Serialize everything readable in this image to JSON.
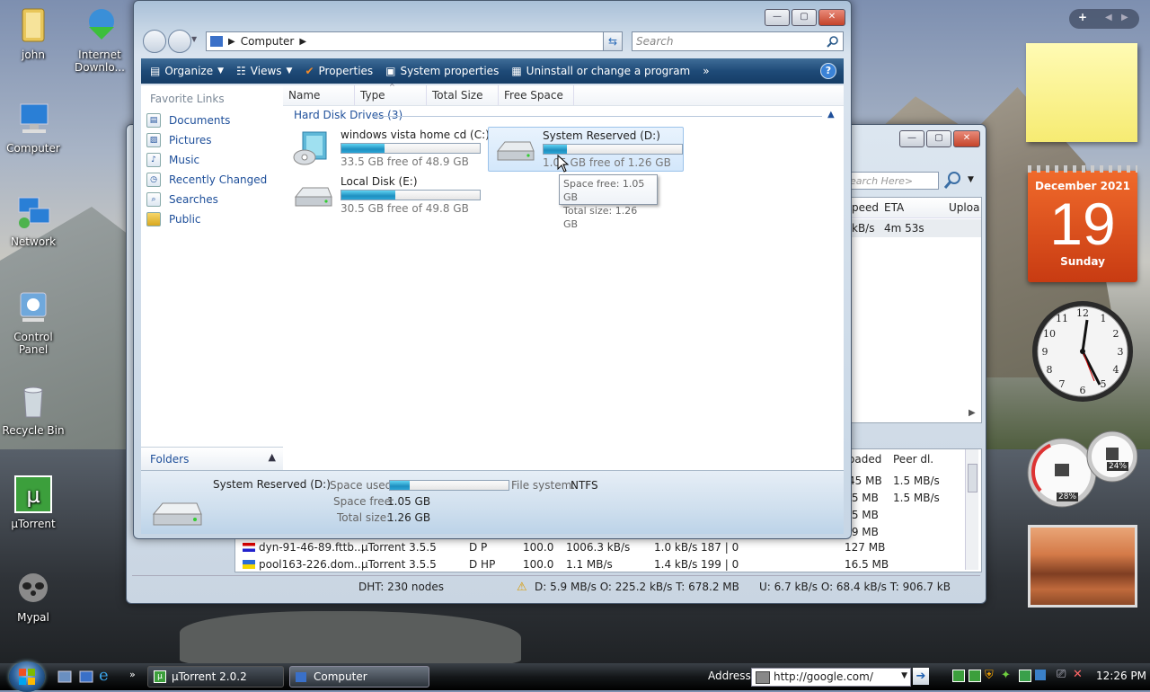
{
  "desktop": {
    "icons": [
      {
        "label": "john"
      },
      {
        "label": "Internet Downlo..."
      },
      {
        "label": "Computer"
      },
      {
        "label": "Network"
      },
      {
        "label": "Control Panel"
      },
      {
        "label": "Recycle Bin"
      },
      {
        "label": "µTorrent"
      },
      {
        "label": "Mypal"
      }
    ]
  },
  "explorer": {
    "address": "Computer",
    "search_placeholder": "Search",
    "toolbar": {
      "organize": "Organize",
      "views": "Views",
      "properties": "Properties",
      "system_properties": "System properties",
      "uninstall": "Uninstall or change a program",
      "more": "»"
    },
    "favorites_header": "Favorite Links",
    "favorites": [
      {
        "label": "Documents"
      },
      {
        "label": "Pictures"
      },
      {
        "label": "Music"
      },
      {
        "label": "Recently Changed"
      },
      {
        "label": "Searches"
      },
      {
        "label": "Public"
      }
    ],
    "folders_label": "Folders",
    "columns": [
      "Name",
      "Type",
      "Total Size",
      "Free Space"
    ],
    "group_header": "Hard Disk Drives (3)",
    "drives": [
      {
        "name": "windows vista home cd (C:)",
        "free": "33.5 GB free of 48.9 GB",
        "used_fraction": 0.31
      },
      {
        "name": "System Reserved (D:)",
        "free": "1.05 GB free of 1.26 GB",
        "used_fraction": 0.17
      },
      {
        "name": "Local Disk (E:)",
        "free": "30.5 GB free of 49.8 GB",
        "used_fraction": 0.39
      }
    ],
    "tooltip": {
      "line1": "Space free: 1.05 GB",
      "line2": "Total size: 1.26 GB"
    },
    "details": {
      "name": "System Reserved (D:)",
      "space_used_label": "Space used:",
      "space_used_fraction": 0.17,
      "filesystem_label": "File system:",
      "filesystem_value": "NTFS",
      "space_free_label": "Space free:",
      "space_free_value": "1.05 GB",
      "total_size_label": "Total size:",
      "total_size_value": "1.26 GB"
    }
  },
  "utorrent": {
    "search_placeholder": "earch Here>",
    "top_cols": {
      "speed": "peed",
      "eta": "ETA",
      "upload": "Uploa"
    },
    "top_row": {
      "speed": "kB/s",
      "eta": "4m 53s"
    },
    "peer_cols": {
      "loaded": "oaded",
      "peer_dl": "Peer dl."
    },
    "peer_partial": [
      {
        "loaded": "45 MB",
        "peer_dl": "1.5 MB/s"
      },
      {
        "loaded": ".5 MB",
        "peer_dl": "1.5 MB/s"
      },
      {
        "loaded": ".5 MB",
        "peer_dl": ""
      },
      {
        "loaded": ".9 MB",
        "peer_dl": ""
      }
    ],
    "peers": [
      {
        "host": "dyn-91-46-89.fttb...",
        "client": "µTorrent 3.5.5",
        "flags": "D P",
        "pct": "100.0",
        "down": "1006.3 kB/s",
        "up": "1.0 kB/s",
        "reqs": "187 | 0",
        "downloaded": "127 MB"
      },
      {
        "host": "pool163-226.dom...",
        "client": "µTorrent 3.5.5",
        "flags": "D HP",
        "pct": "100.0",
        "down": "1.1 MB/s",
        "up": "1.4 kB/s",
        "reqs": "199 | 0",
        "downloaded": "16.5 MB"
      }
    ],
    "status": {
      "dht": "DHT: 230 nodes",
      "download": "D: 5.9 MB/s O: 225.2 kB/s T: 678.2 MB",
      "upload": "U: 6.7 kB/s O: 68.4 kB/s T: 906.7 kB"
    }
  },
  "gadgets": {
    "calendar": {
      "month": "December 2021",
      "day": "19",
      "weekday": "Sunday"
    },
    "cpu": {
      "cpu_pct": "28%",
      "mem_pct": "24%"
    }
  },
  "taskbar": {
    "tasks": [
      {
        "label": "µTorrent 2.0.2"
      },
      {
        "label": "Computer"
      }
    ],
    "address_label": "Address",
    "address_value": "http://google.com/",
    "clock": "12:26 PM"
  }
}
